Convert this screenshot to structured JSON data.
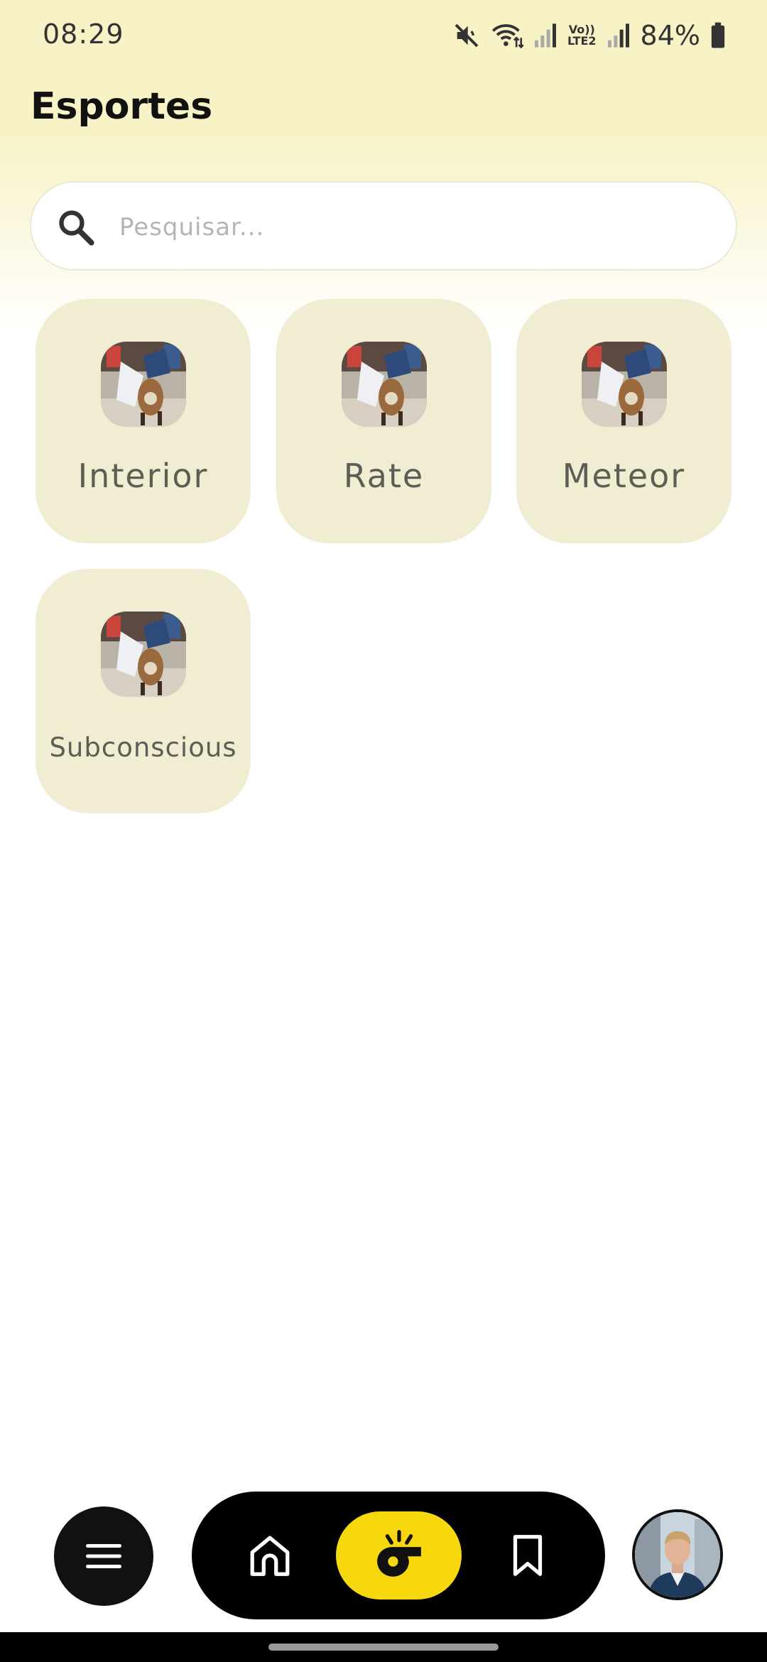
{
  "status_bar": {
    "time": "08:29",
    "battery": "84%",
    "network_label_top": "Vo))",
    "network_label_bottom": "LTE2",
    "icons": [
      "mute-icon",
      "wifi-icon",
      "signal-icon",
      "signal-icon",
      "battery-icon"
    ]
  },
  "header": {
    "title": "Esportes"
  },
  "search": {
    "placeholder": "Pesquisar...",
    "value": ""
  },
  "categories": [
    {
      "label": "Interior"
    },
    {
      "label": "Rate"
    },
    {
      "label": "Meteor"
    },
    {
      "label": "Subconscious"
    }
  ],
  "bottom_nav": {
    "items": [
      "menu-icon",
      "home-icon",
      "whistle-icon",
      "bookmark-icon",
      "avatar"
    ],
    "active": "whistle-icon",
    "accent_color": "#f7d80e"
  },
  "colors": {
    "background_top": "#f8f3c6",
    "card_background": "#f1edd3",
    "nav_background": "#000000"
  }
}
